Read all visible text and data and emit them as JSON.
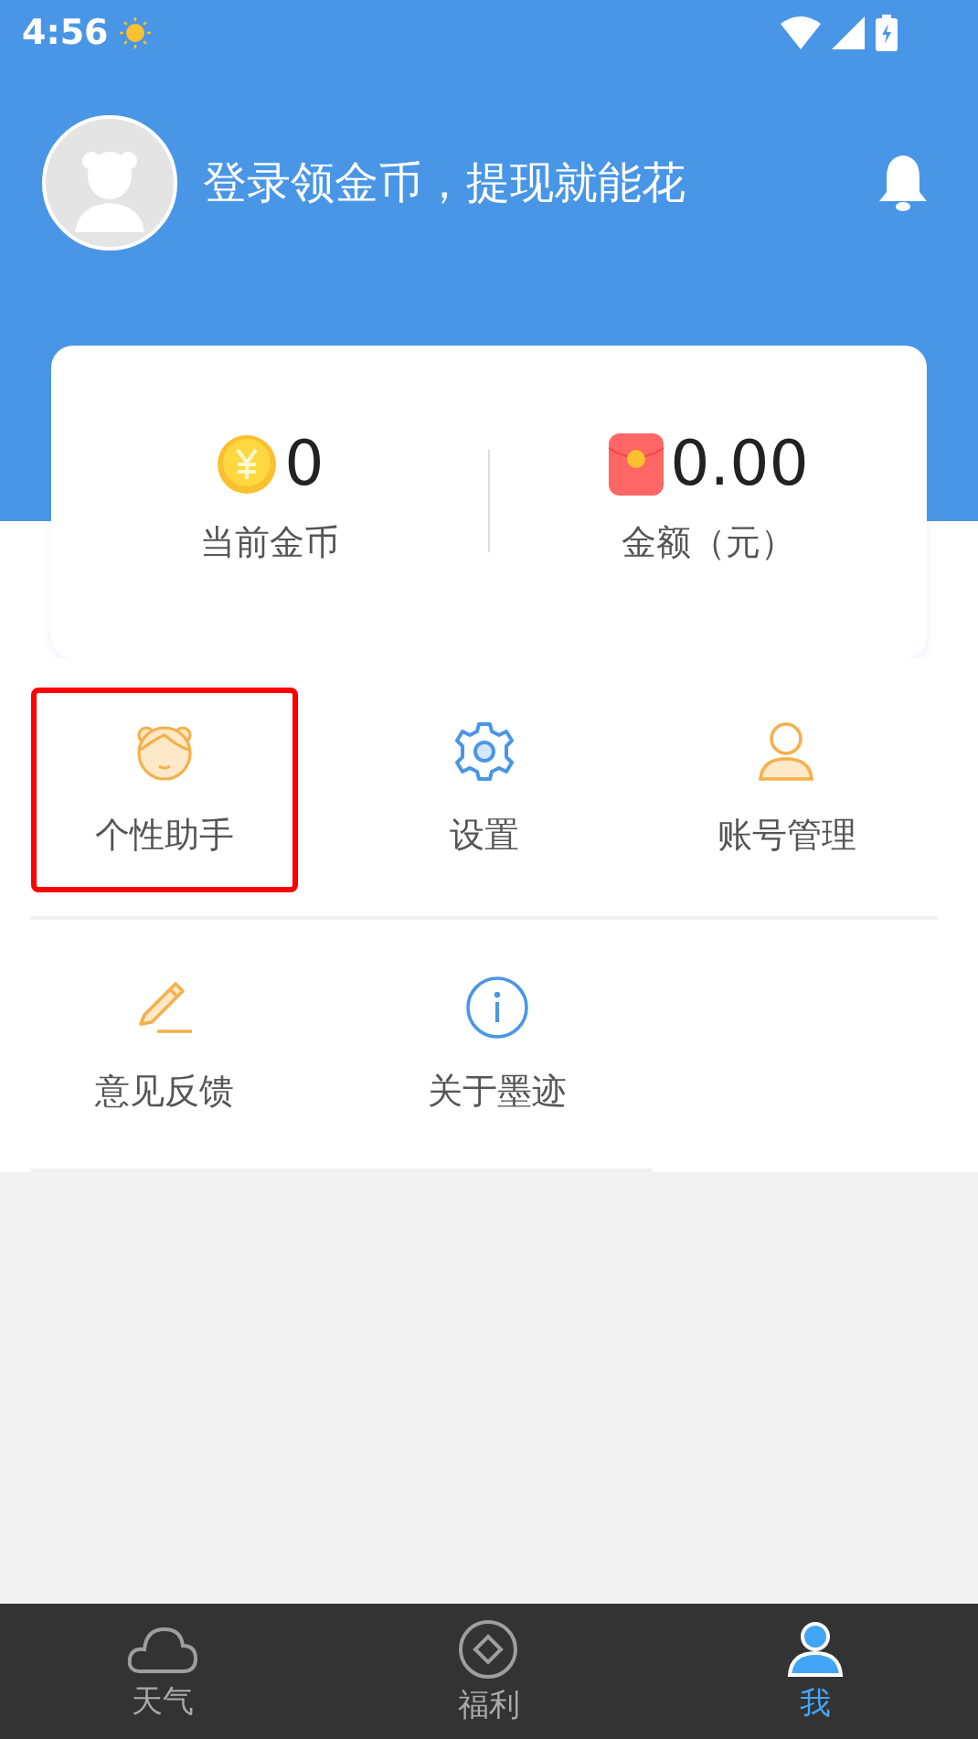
{
  "status_bar": {
    "time": "4:56"
  },
  "header": {
    "login_prompt": "登录领金币，提现就能花"
  },
  "wallet": [
    {
      "kind": "coins",
      "value": "0",
      "label": "当前金币"
    },
    {
      "kind": "cash",
      "value": "0.00",
      "label": "金额（元）"
    }
  ],
  "menu_rows": [
    [
      {
        "kind": "assistant",
        "label": "个性助手",
        "selected": true
      },
      {
        "kind": "settings",
        "label": "设置",
        "selected": false
      },
      {
        "kind": "account",
        "label": "账号管理",
        "selected": false
      }
    ],
    [
      {
        "kind": "feedback",
        "label": "意见反馈",
        "selected": false
      },
      {
        "kind": "about",
        "label": "关于墨迹",
        "selected": false
      }
    ]
  ],
  "tabs": [
    {
      "kind": "weather",
      "label": "天气",
      "selected": false
    },
    {
      "kind": "welfare",
      "label": "福利",
      "selected": false
    },
    {
      "kind": "me",
      "label": "我",
      "selected": true
    }
  ]
}
